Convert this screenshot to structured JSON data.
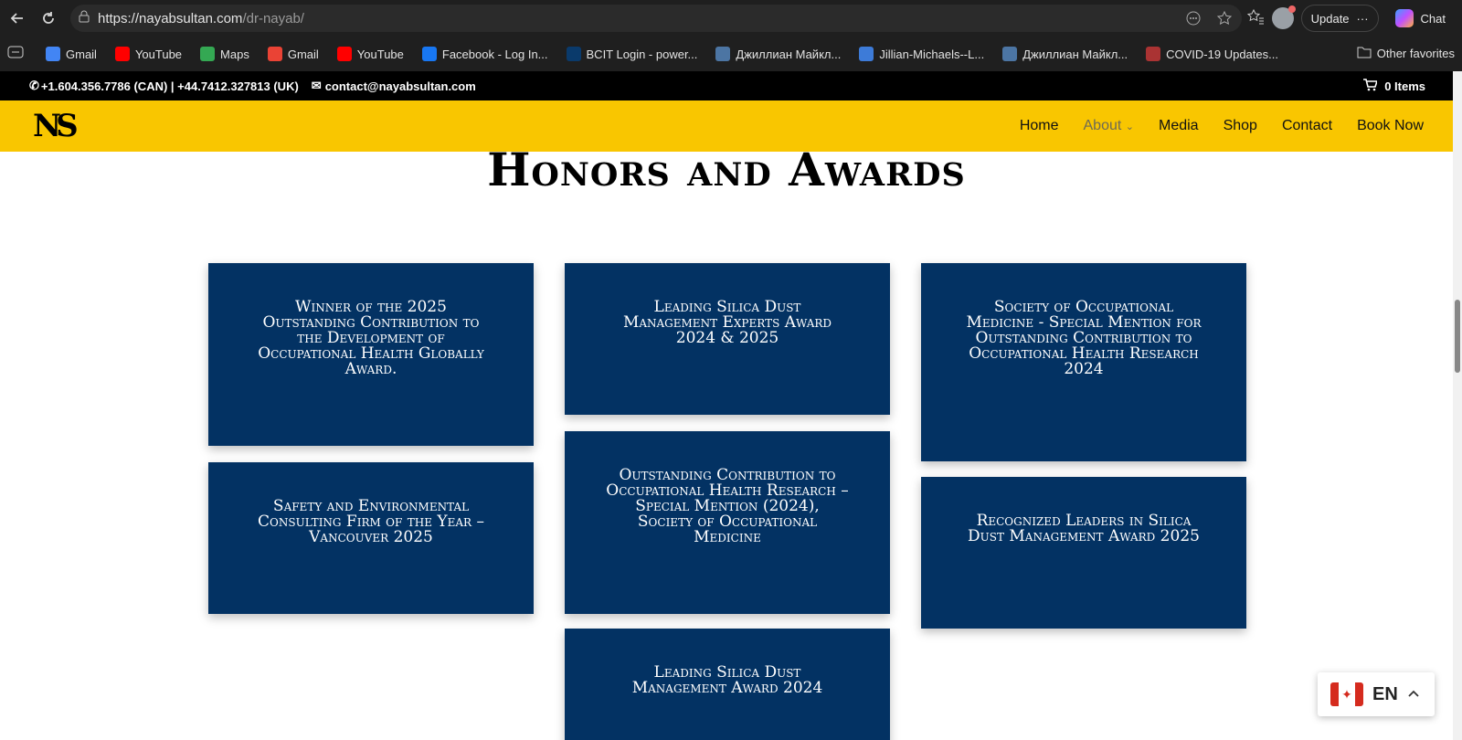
{
  "browser": {
    "url_host": "https://nayabsultan.com",
    "url_path": "/dr-nayab/",
    "update_label": "Update",
    "chat_label": "Chat",
    "other_favorites": "Other favorites",
    "bookmarks": [
      {
        "label": "Gmail",
        "icon": "google-icon",
        "color": "#4285f4"
      },
      {
        "label": "YouTube",
        "icon": "youtube-icon",
        "color": "#ff0000"
      },
      {
        "label": "Maps",
        "icon": "maps-icon",
        "color": "#34a853"
      },
      {
        "label": "Gmail",
        "icon": "gmail-icon",
        "color": "#ea4335"
      },
      {
        "label": "YouTube",
        "icon": "youtube-icon",
        "color": "#ff0000"
      },
      {
        "label": "Facebook - Log In...",
        "icon": "facebook-icon",
        "color": "#1877f2"
      },
      {
        "label": "BCIT Login - power...",
        "icon": "bcit-icon",
        "color": "#0a3a6b"
      },
      {
        "label": "Джиллиан Майкл...",
        "icon": "vk-icon",
        "color": "#4c75a3"
      },
      {
        "label": "Jillian-Michaels--L...",
        "icon": "video-icon",
        "color": "#3d7bd8"
      },
      {
        "label": "Джиллиан Майкл...",
        "icon": "vk-icon",
        "color": "#4c75a3"
      },
      {
        "label": "COVID-19 Updates...",
        "icon": "covid-icon",
        "color": "#a33"
      }
    ]
  },
  "site": {
    "phone": "+1.604.356.7786 (CAN) | +44.7412.327813 (UK)",
    "email": "contact@nayabsultan.com",
    "cart": "0 Items",
    "menu": [
      "Home",
      "About",
      "Media",
      "Shop",
      "Contact",
      "Book Now"
    ],
    "heading": "Honors and Awards",
    "awards": [
      "Winner of the 2025 Outstanding Contribution to the Development of Occupational Health Globally Award.",
      "Leading Silica Dust Management Experts Award 2024 & 2025",
      "Society of Occupational Medicine - Special Mention for Outstanding Contribution to Occupational Health Research 2024",
      "Safety and Environmental Consulting Firm of the Year – Vancouver 2025",
      "Outstanding Contribution to Occupational Health Research – Special Mention (2024), Society of Occupational Medicine",
      "Recognized Leaders in Silica Dust Management Award 2025",
      "Leading Silica Dust Management Award 2024"
    ],
    "language": "EN"
  },
  "colors": {
    "accent_yellow": "#f9c600",
    "card_blue": "#033263"
  }
}
